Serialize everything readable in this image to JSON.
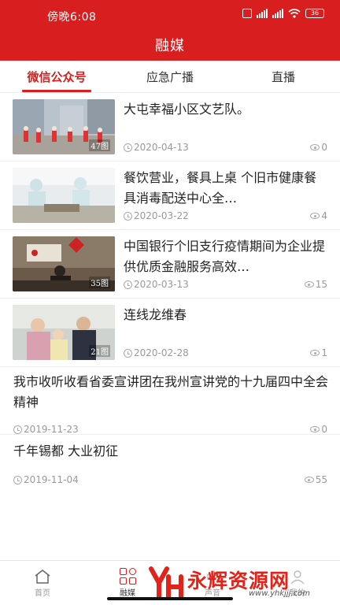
{
  "status": {
    "time": "傍晚6:08",
    "battery": "36"
  },
  "header": {
    "title": "融媒"
  },
  "tabs": [
    {
      "label": "微信公众号",
      "active": true
    },
    {
      "label": "应急广播",
      "active": false
    },
    {
      "label": "直播",
      "active": false
    }
  ],
  "articles": [
    {
      "title": "大屯幸福小区文艺队。",
      "date": "2020-04-13",
      "views": "0",
      "img_count": "47图"
    },
    {
      "title": "  餐饮营业，餐具上桌    个旧市健康餐具消毒配送中心全…",
      "date": "2020-03-22",
      "views": "4"
    },
    {
      "title": "中国银行个旧支行疫情期间为企业提供优质金融服务高效…",
      "date": "2020-03-13",
      "views": "15",
      "img_count": "35图"
    },
    {
      "title": "连线龙维春",
      "date": "2020-02-28",
      "views": "1",
      "img_count": "21图"
    },
    {
      "title": "我市收听收看省委宣讲团在我州宣讲党的十九届四中全会精神",
      "date": "2019-11-23",
      "views": "0"
    },
    {
      "title": "千年锡都    大业初征",
      "date": "2019-11-04",
      "views": "55"
    }
  ],
  "bottom_nav": [
    {
      "label": "首页",
      "icon": "home-icon",
      "active": false
    },
    {
      "label": "融媒",
      "icon": "grid-icon",
      "active": true
    },
    {
      "label": "声音",
      "icon": "sound-icon",
      "active": false
    },
    {
      "label": "我的",
      "icon": "user-icon",
      "active": false
    }
  ],
  "watermark": {
    "text": "永辉资源网",
    "url": "www.yhkjjj.com"
  },
  "colors": {
    "brand": "#d81e1e",
    "meta": "#999999"
  }
}
